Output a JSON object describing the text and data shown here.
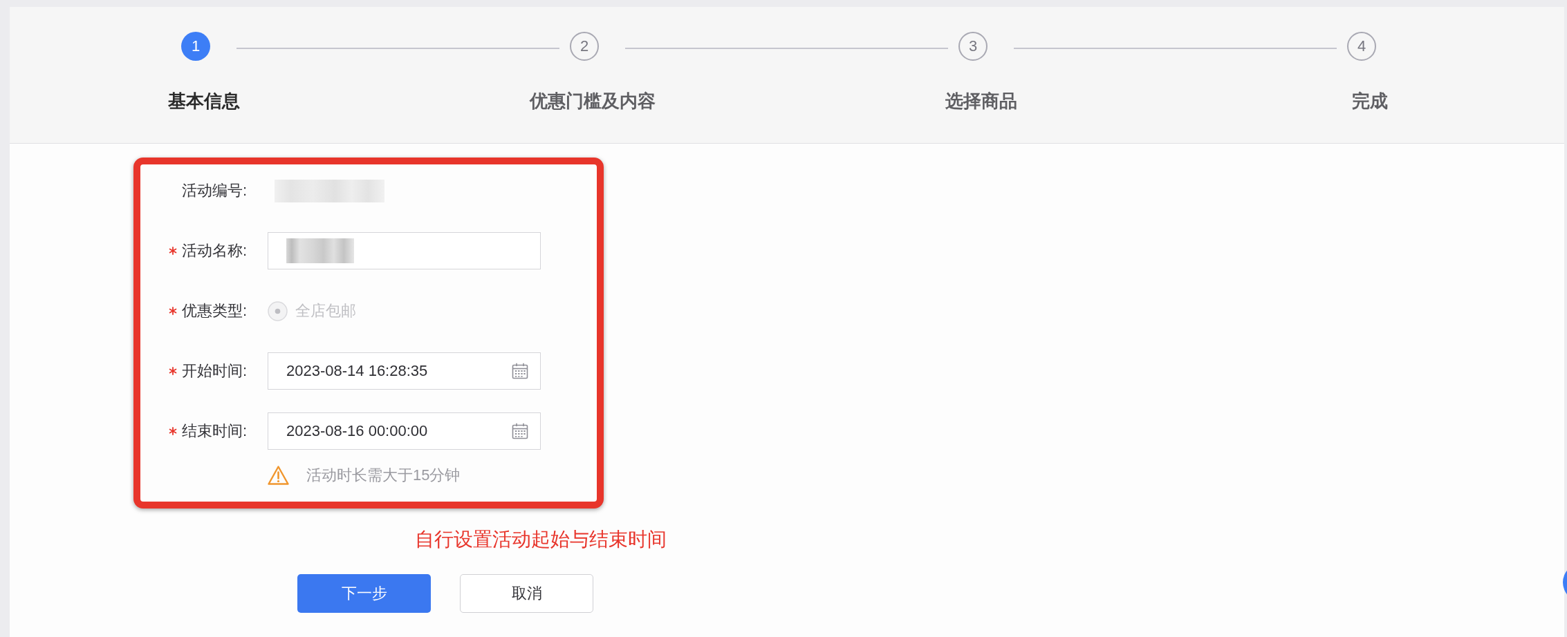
{
  "steps": [
    {
      "number": "1",
      "label": "基本信息",
      "selected": true
    },
    {
      "number": "2",
      "label": "优惠门槛及内容",
      "selected": false
    },
    {
      "number": "3",
      "label": "选择商品",
      "selected": false
    },
    {
      "number": "4",
      "label": "完成",
      "selected": false
    }
  ],
  "form": {
    "fields": [
      {
        "kind": "static",
        "label": "活动编号:",
        "required": false,
        "value_blurred": true
      },
      {
        "kind": "text",
        "label": "活动名称:",
        "required": true,
        "value_blurred": true
      },
      {
        "kind": "radio",
        "label": "优惠类型:",
        "required": true,
        "options": [
          {
            "label": "全店包邮",
            "selected": true,
            "disabled": true
          }
        ]
      },
      {
        "kind": "datetime",
        "label": "开始时间:",
        "required": true,
        "value": "2023-08-14 16:28:35"
      },
      {
        "kind": "datetime",
        "label": "结束时间:",
        "required": true,
        "value": "2023-08-16 00:00:00",
        "warning": "活动时长需大于15分钟"
      }
    ]
  },
  "annotation": {
    "text": "自行设置活动起始与结束时间"
  },
  "buttons": [
    {
      "label": "下一步",
      "kind": "primary"
    },
    {
      "label": "取消",
      "kind": "default"
    }
  ]
}
